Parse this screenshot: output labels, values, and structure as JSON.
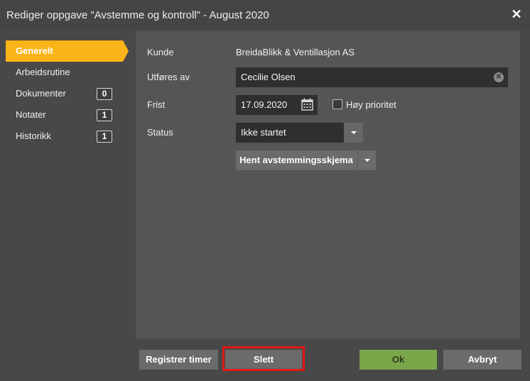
{
  "dialog": {
    "title": "Rediger oppgave \"Avstemme og kontroll\" - August 2020",
    "close_glyph": "✕"
  },
  "sidebar": {
    "items": [
      {
        "label": "Generelt",
        "active": true
      },
      {
        "label": "Arbeidsrutine"
      },
      {
        "label": "Dokumenter",
        "count": "0"
      },
      {
        "label": "Notater",
        "count": "1"
      },
      {
        "label": "Historikk",
        "count": "1"
      }
    ]
  },
  "form": {
    "kunde_label": "Kunde",
    "kunde_value": "BreidaBlikk & Ventillasjon AS",
    "utfores_label": "Utføres av",
    "utfores_value": "Cecilie Olsen",
    "frist_label": "Frist",
    "frist_value": "17.09.2020",
    "priority_label": "Høy prioritet",
    "priority_checked": false,
    "status_label": "Status",
    "status_value": "Ikke startet",
    "fetch_button": "Hent avstemmingsskjema"
  },
  "footer": {
    "register_button": "Registrer timer",
    "delete_button": "Slett",
    "ok_button": "Ok",
    "cancel_button": "Avbryt"
  },
  "colors": {
    "accent": "#fbb417",
    "ok": "#7aa64a",
    "highlight": "#e01818"
  },
  "icons": [
    "close-icon",
    "clear-icon",
    "calendar-icon",
    "chevron-down-icon"
  ]
}
